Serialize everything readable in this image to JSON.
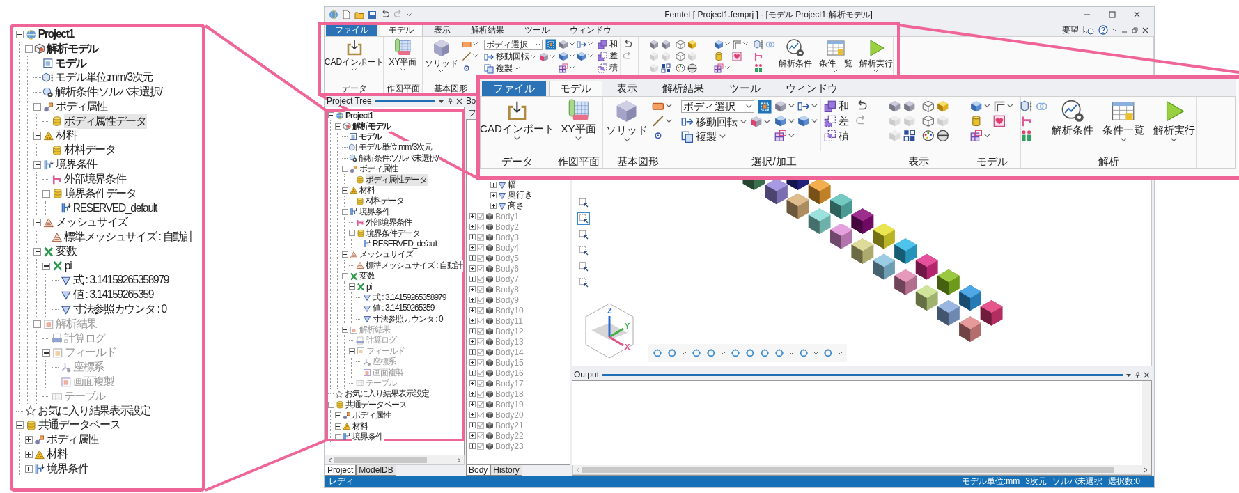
{
  "magnified_project_tree": {
    "items": [
      {
        "label": "Project1",
        "kind": "project",
        "expanded": true,
        "active": true,
        "disabled": false,
        "selected": false,
        "children": [
          {
            "label": "解析モデル",
            "kind": "analysis-model",
            "expanded": true,
            "active": true,
            "disabled": false,
            "selected": false,
            "children": [
              {
                "label": "モデル",
                "kind": "model",
                "active": true,
                "disabled": false,
                "selected": false
              },
              {
                "label": "モデル単位:mm/3次元",
                "kind": "unit",
                "active": false,
                "disabled": false,
                "selected": false
              },
              {
                "label": "解析条件:ソルバ未選択/",
                "kind": "condition",
                "active": false,
                "disabled": false,
                "selected": false
              },
              {
                "label": "ボディ属性",
                "kind": "body-attr",
                "expanded": true,
                "active": false,
                "disabled": false,
                "selected": false,
                "children": [
                  {
                    "label": "ボディ属性データ",
                    "kind": "data",
                    "active": false,
                    "disabled": false,
                    "selected": true
                  }
                ]
              },
              {
                "label": "材料",
                "kind": "material",
                "expanded": true,
                "active": false,
                "disabled": false,
                "selected": false,
                "children": [
                  {
                    "label": "材料データ",
                    "kind": "data",
                    "active": false,
                    "disabled": false,
                    "selected": false
                  }
                ]
              },
              {
                "label": "境界条件",
                "kind": "boundary",
                "expanded": true,
                "active": false,
                "disabled": false,
                "selected": false,
                "children": [
                  {
                    "label": "外部境界条件",
                    "kind": "external",
                    "active": false,
                    "disabled": false,
                    "selected": false
                  },
                  {
                    "label": "境界条件データ",
                    "kind": "data",
                    "expanded": true,
                    "active": false,
                    "disabled": false,
                    "selected": false,
                    "children": [
                      {
                        "label": "RESERVED_default",
                        "kind": "boundary",
                        "active": false,
                        "disabled": false,
                        "selected": false
                      }
                    ]
                  }
                ]
              },
              {
                "label": "メッシュサイズ",
                "kind": "mesh",
                "expanded": true,
                "active": false,
                "disabled": false,
                "selected": false,
                "children": [
                  {
                    "label": "標準メッシュサイズ : 自動計",
                    "kind": "mesh",
                    "active": false,
                    "disabled": false,
                    "selected": false
                  }
                ]
              },
              {
                "label": "変数",
                "kind": "variable",
                "expanded": true,
                "active": false,
                "disabled": false,
                "selected": false,
                "children": [
                  {
                    "label": "pi",
                    "kind": "variable",
                    "expanded": true,
                    "active": false,
                    "disabled": false,
                    "selected": false,
                    "children": [
                      {
                        "label": "式 : 3.14159265358979",
                        "kind": "parameter",
                        "active": false,
                        "disabled": false,
                        "selected": false
                      },
                      {
                        "label": "値 : 3.14159265359",
                        "kind": "parameter",
                        "active": false,
                        "disabled": false,
                        "selected": false
                      },
                      {
                        "label": "寸法参照カウンタ : 0",
                        "kind": "parameter",
                        "active": false,
                        "disabled": false,
                        "selected": false
                      }
                    ]
                  }
                ]
              },
              {
                "label": "解析結果",
                "kind": "result",
                "expanded": true,
                "active": false,
                "disabled": true,
                "selected": false,
                "children": [
                  {
                    "label": "計算ログ",
                    "kind": "log",
                    "active": false,
                    "disabled": true,
                    "selected": false
                  },
                  {
                    "label": "フィールド",
                    "kind": "field",
                    "expanded": true,
                    "active": false,
                    "disabled": true,
                    "selected": false,
                    "children": [
                      {
                        "label": "座標系",
                        "kind": "coords",
                        "active": false,
                        "disabled": true,
                        "selected": false
                      },
                      {
                        "label": "画面複製",
                        "kind": "capture",
                        "active": false,
                        "disabled": true,
                        "selected": false
                      }
                    ]
                  },
                  {
                    "label": "テーブル",
                    "kind": "table",
                    "active": false,
                    "disabled": true,
                    "selected": false
                  }
                ]
              }
            ]
          }
        ]
      },
      {
        "label": "お気に入り結果表示設定",
        "kind": "favorite",
        "active": false,
        "disabled": false,
        "selected": false
      },
      {
        "label": "共通データベース",
        "kind": "data",
        "expanded": true,
        "active": false,
        "disabled": false,
        "selected": false,
        "children": [
          {
            "label": "ボディ属性",
            "kind": "body-attr",
            "expanded": false,
            "active": false,
            "disabled": false,
            "selected": false
          },
          {
            "label": "材料",
            "kind": "material",
            "expanded": false,
            "active": false,
            "disabled": false,
            "selected": false
          },
          {
            "label": "境界条件",
            "kind": "boundary",
            "expanded": false,
            "active": false,
            "disabled": false,
            "selected": false
          }
        ]
      }
    ]
  },
  "window": {
    "title": "Femtet [ Project1.femprj ] - [モデル Project1:解析モデル]",
    "request_label": "要望"
  },
  "ribbon": {
    "tabs": [
      {
        "label": "ファイル",
        "kind": "menu",
        "selected": false
      },
      {
        "label": "モデル",
        "kind": "tab",
        "selected": true
      },
      {
        "label": "表示",
        "kind": "tab",
        "selected": false
      },
      {
        "label": "解析結果",
        "kind": "tab",
        "selected": false
      },
      {
        "label": "ツール",
        "kind": "tab",
        "selected": false
      },
      {
        "label": "ウィンドウ",
        "kind": "tab",
        "selected": false
      }
    ],
    "groups": [
      {
        "kind": "import",
        "label": "データ",
        "buttons": [
          "CADインポート"
        ]
      },
      {
        "kind": "plane",
        "label": "作図平面",
        "buttons": [
          "XY平面"
        ]
      },
      {
        "kind": "shape",
        "label": "基本図形",
        "buttons": [
          "ソリッド"
        ]
      },
      {
        "kind": "select",
        "selector": {
          "value": "ボディ選択"
        },
        "buttons": [
          "移動回転",
          "複製"
        ],
        "booleans": [
          "和",
          "差",
          "積"
        ]
      },
      {
        "kind": "view"
      },
      {
        "kind": "model"
      },
      {
        "kind": "analysis",
        "buttons": [
          "解析条件",
          "条件一覧",
          "解析実行"
        ]
      }
    ]
  },
  "magnified_ribbon": {
    "tabs": [
      {
        "label": "ファイル",
        "kind": "menu",
        "selected": false
      },
      {
        "label": "モデル",
        "kind": "tab",
        "selected": true
      },
      {
        "label": "表示",
        "kind": "tab",
        "selected": false
      },
      {
        "label": "解析結果",
        "kind": "tab",
        "selected": false
      },
      {
        "label": "ツール",
        "kind": "tab",
        "selected": false
      },
      {
        "label": "ウィンドウ",
        "kind": "tab",
        "selected": false
      }
    ],
    "groups": [
      {
        "kind": "import",
        "label": "データ",
        "buttons": [
          "CADインポート"
        ]
      },
      {
        "kind": "plane",
        "label": "作図平面",
        "buttons": [
          "XY平面"
        ]
      },
      {
        "kind": "shape",
        "label": "基本図形",
        "buttons": [
          "ソリッド"
        ]
      },
      {
        "kind": "select",
        "label": "選択/加工",
        "selector": {
          "value": "ボディ選択"
        },
        "buttons": [
          "移動回転",
          "複製"
        ],
        "booleans": [
          "和",
          "差",
          "積"
        ]
      },
      {
        "kind": "view",
        "label": "表示"
      },
      {
        "kind": "model",
        "label": "モデル"
      },
      {
        "kind": "analysis",
        "label": "解析",
        "buttons": [
          "解析条件",
          "条件一覧",
          "解析実行"
        ]
      }
    ]
  },
  "project_tree": {
    "title": "Project Tree",
    "items": [
      {
        "label": "Project1",
        "kind": "project",
        "expanded": true,
        "active": true,
        "disabled": false,
        "selected": false,
        "children": [
          {
            "label": "解析モデル",
            "kind": "analysis-model",
            "expanded": true,
            "active": true,
            "disabled": false,
            "selected": false,
            "children": [
              {
                "label": "モデル",
                "kind": "model",
                "active": true,
                "disabled": false,
                "selected": false
              },
              {
                "label": "モデル単位:mm/3次元",
                "kind": "unit",
                "active": false,
                "disabled": false,
                "selected": false
              },
              {
                "label": "解析条件:ソルバ未選択/",
                "kind": "condition",
                "active": false,
                "disabled": false,
                "selected": false
              },
              {
                "label": "ボディ属性",
                "kind": "body-attr",
                "expanded": true,
                "active": false,
                "disabled": false,
                "selected": false,
                "children": [
                  {
                    "label": "ボディ属性データ",
                    "kind": "data",
                    "active": false,
                    "disabled": false,
                    "selected": true
                  }
                ]
              },
              {
                "label": "材料",
                "kind": "material",
                "expanded": true,
                "active": false,
                "disabled": false,
                "selected": false,
                "children": [
                  {
                    "label": "材料データ",
                    "kind": "data",
                    "active": false,
                    "disabled": false,
                    "selected": false
                  }
                ]
              },
              {
                "label": "境界条件",
                "kind": "boundary",
                "expanded": true,
                "active": false,
                "disabled": false,
                "selected": false,
                "children": [
                  {
                    "label": "外部境界条件",
                    "kind": "external",
                    "active": false,
                    "disabled": false,
                    "selected": false
                  },
                  {
                    "label": "境界条件データ",
                    "kind": "data",
                    "expanded": true,
                    "active": false,
                    "disabled": false,
                    "selected": false,
                    "children": [
                      {
                        "label": "RESERVED_default",
                        "kind": "boundary",
                        "active": false,
                        "disabled": false,
                        "selected": false
                      }
                    ]
                  }
                ]
              },
              {
                "label": "メッシュサイズ",
                "kind": "mesh",
                "expanded": true,
                "active": false,
                "disabled": false,
                "selected": false,
                "children": [
                  {
                    "label": "標準メッシュサイズ : 自動計",
                    "kind": "mesh",
                    "active": false,
                    "disabled": false,
                    "selected": false
                  }
                ]
              },
              {
                "label": "変数",
                "kind": "variable",
                "expanded": true,
                "active": false,
                "disabled": false,
                "selected": false,
                "children": [
                  {
                    "label": "pi",
                    "kind": "variable",
                    "expanded": true,
                    "active": false,
                    "disabled": false,
                    "selected": false,
                    "children": [
                      {
                        "label": "式 : 3.14159265358979",
                        "kind": "parameter",
                        "active": false,
                        "disabled": false,
                        "selected": false
                      },
                      {
                        "label": "値 : 3.14159265359",
                        "kind": "parameter",
                        "active": false,
                        "disabled": false,
                        "selected": false
                      },
                      {
                        "label": "寸法参照カウンタ : 0",
                        "kind": "parameter",
                        "active": false,
                        "disabled": false,
                        "selected": false
                      }
                    ]
                  }
                ]
              },
              {
                "label": "解析結果",
                "kind": "result",
                "expanded": true,
                "active": false,
                "disabled": true,
                "selected": false,
                "children": [
                  {
                    "label": "計算ログ",
                    "kind": "log",
                    "active": false,
                    "disabled": true,
                    "selected": false
                  },
                  {
                    "label": "フィールド",
                    "kind": "field",
                    "expanded": true,
                    "active": false,
                    "disabled": true,
                    "selected": false,
                    "children": [
                      {
                        "label": "座標系",
                        "kind": "coords",
                        "active": false,
                        "disabled": true,
                        "selected": false
                      },
                      {
                        "label": "画面複製",
                        "kind": "capture",
                        "active": false,
                        "disabled": true,
                        "selected": false
                      }
                    ]
                  },
                  {
                    "label": "テーブル",
                    "kind": "table",
                    "active": false,
                    "disabled": true,
                    "selected": false
                  }
                ]
              }
            ]
          }
        ]
      },
      {
        "label": "お気に入り結果表示設定",
        "kind": "favorite",
        "active": false,
        "disabled": false,
        "selected": false
      },
      {
        "label": "共通データベース",
        "kind": "data",
        "expanded": true,
        "active": false,
        "disabled": false,
        "selected": false,
        "children": [
          {
            "label": "ボディ属性",
            "kind": "body-attr",
            "expanded": false,
            "active": false,
            "disabled": false,
            "selected": false
          },
          {
            "label": "材料",
            "kind": "material",
            "expanded": false,
            "active": false,
            "disabled": false,
            "selected": false
          },
          {
            "label": "境界条件",
            "kind": "boundary",
            "expanded": false,
            "active": false,
            "disabled": false,
            "selected": false
          }
        ]
      }
    ],
    "tabs": [
      {
        "label": "Project",
        "selected": true
      },
      {
        "label": "ModelDB",
        "selected": false
      }
    ]
  },
  "body_tree": {
    "title": "Bo",
    "filter_label": "フ",
    "parameters": [
      {
        "label": "幅",
        "expanded": false,
        "selected": false
      },
      {
        "label": "奥行き",
        "expanded": false,
        "selected": false
      },
      {
        "label": "高さ",
        "expanded": false,
        "selected": false
      }
    ],
    "bodies": [
      {
        "label": "Body1",
        "expanded": false,
        "checked": true,
        "selected": false
      },
      {
        "label": "Body2",
        "expanded": false,
        "checked": true,
        "selected": false
      },
      {
        "label": "Body3",
        "expanded": false,
        "checked": true,
        "selected": false
      },
      {
        "label": "Body4",
        "expanded": false,
        "checked": true,
        "selected": false
      },
      {
        "label": "Body5",
        "expanded": false,
        "checked": true,
        "selected": false
      },
      {
        "label": "Body6",
        "expanded": false,
        "checked": true,
        "selected": false
      },
      {
        "label": "Body7",
        "expanded": false,
        "checked": true,
        "selected": false
      },
      {
        "label": "Body8",
        "expanded": false,
        "checked": true,
        "selected": false
      },
      {
        "label": "Body9",
        "expanded": false,
        "checked": true,
        "selected": false
      },
      {
        "label": "Body10",
        "expanded": false,
        "checked": true,
        "selected": false
      },
      {
        "label": "Body11",
        "expanded": false,
        "checked": true,
        "selected": false
      },
      {
        "label": "Body12",
        "expanded": false,
        "checked": true,
        "selected": false
      },
      {
        "label": "Body13",
        "expanded": false,
        "checked": true,
        "selected": false
      },
      {
        "label": "Body14",
        "expanded": false,
        "checked": true,
        "selected": false
      },
      {
        "label": "Body15",
        "expanded": false,
        "checked": true,
        "selected": false
      },
      {
        "label": "Body16",
        "expanded": false,
        "checked": true,
        "selected": false
      },
      {
        "label": "Body17",
        "expanded": false,
        "checked": true,
        "selected": false
      },
      {
        "label": "Body18",
        "expanded": false,
        "checked": true,
        "selected": false
      },
      {
        "label": "Body19",
        "expanded": false,
        "checked": true,
        "selected": false
      },
      {
        "label": "Body20",
        "expanded": false,
        "checked": true,
        "selected": false
      },
      {
        "label": "Body21",
        "expanded": false,
        "checked": true,
        "selected": false
      },
      {
        "label": "Body22",
        "expanded": false,
        "checked": true,
        "selected": false
      },
      {
        "label": "Body23",
        "expanded": false,
        "checked": true,
        "selected": false
      }
    ],
    "tabs": [
      {
        "label": "Body",
        "selected": true
      },
      {
        "label": "History",
        "selected": false
      }
    ]
  },
  "viewport": {
    "axis_labels": [
      "Z",
      "Y",
      "X"
    ]
  },
  "output": {
    "title": "Output"
  },
  "status_bar": {
    "text": "レディ",
    "items": [
      "モデル単位:mm",
      "3次元",
      "ソルバ未選択",
      "選択数:0"
    ]
  }
}
